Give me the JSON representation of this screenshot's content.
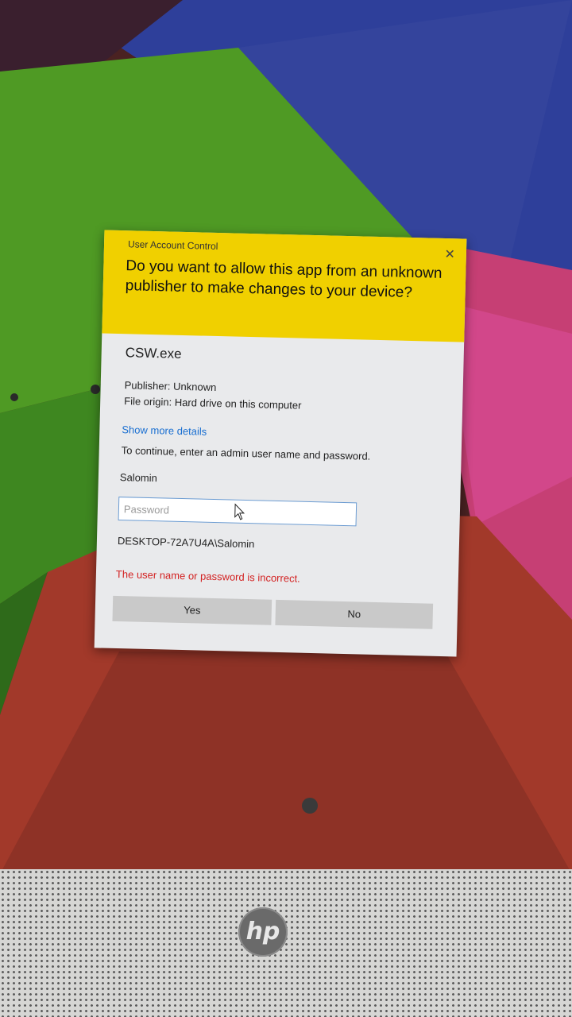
{
  "dialog": {
    "window_title": "User Account Control",
    "close_glyph": "✕",
    "question": "Do you want to allow this app from an unknown publisher to make changes to your device?",
    "app_name": "CSW.exe",
    "publisher_line": "Publisher: Unknown",
    "origin_line": "File origin: Hard drive on this computer",
    "more_details_link": "Show more details",
    "instruction": "To continue, enter an admin user name and password.",
    "user_name": "Salomin",
    "password_placeholder": "Password",
    "domain_user": "DESKTOP-72A7U4A\\Salomin",
    "error_message": "The user name or password is incorrect.",
    "yes_label": "Yes",
    "no_label": "No"
  },
  "device": {
    "logo_text": "hp"
  },
  "colors": {
    "header_yellow": "#f0d000",
    "link_blue": "#1a6fd1",
    "error_red": "#d32222",
    "dialog_bg": "#e9eaec"
  }
}
